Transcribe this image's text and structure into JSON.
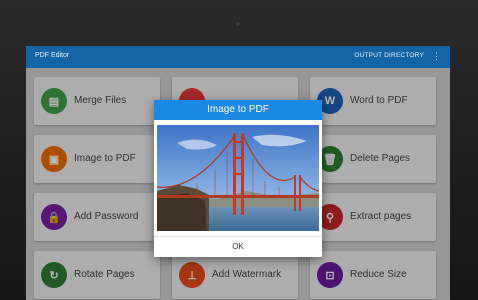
{
  "app": {
    "title": "PDF Editor",
    "output_directory": "OUTPUT DIRECTORY",
    "overflow_menu": "⋮"
  },
  "tiles": [
    {
      "label": "Merge Files",
      "color": "#43a047",
      "icon": "merge-files-icon",
      "glyph": "▤"
    },
    {
      "label": "",
      "color": "#e53935",
      "icon": "pdf-icon",
      "glyph": ""
    },
    {
      "label": "Word to PDF",
      "color": "#1e63b6",
      "icon": "word-icon",
      "glyph": "W"
    },
    {
      "label": "Image to PDF",
      "color": "#ef6c00",
      "icon": "image-icon",
      "glyph": "▣"
    },
    {
      "label": "",
      "color": "#e53935",
      "icon": "pdf-icon",
      "glyph": ""
    },
    {
      "label": "Delete Pages",
      "color": "#2e7d32",
      "icon": "trash-icon",
      "glyph": "🗑"
    },
    {
      "label": "Add Password",
      "color": "#7b1fa2",
      "icon": "lock-icon",
      "glyph": "🔒"
    },
    {
      "label": "",
      "color": "#e53935",
      "icon": "pdf-icon",
      "glyph": ""
    },
    {
      "label": "Extract pages",
      "color": "#c62828",
      "icon": "link-icon",
      "glyph": "⚲"
    },
    {
      "label": "Rotate Pages",
      "color": "#2e7d32",
      "icon": "rotate-icon",
      "glyph": "↻"
    },
    {
      "label": "Add Watermark",
      "color": "#e64a19",
      "icon": "stamp-icon",
      "glyph": "⊥"
    },
    {
      "label": "Reduce Size",
      "color": "#6a1b9a",
      "icon": "compress-icon",
      "glyph": "⊡"
    }
  ],
  "dialog": {
    "title": "Image to PDF",
    "ok_label": "OK"
  }
}
